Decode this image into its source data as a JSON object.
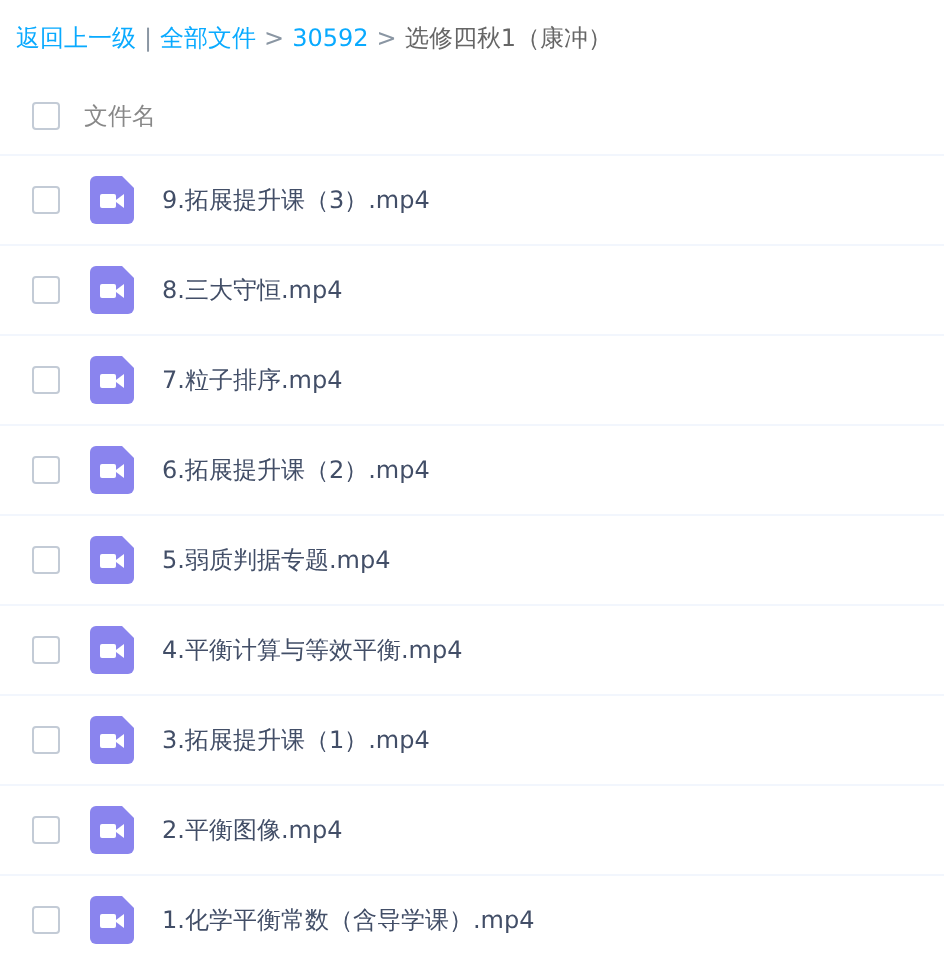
{
  "breadcrumb": [
    {
      "text": "返回上一级",
      "kind": "link"
    },
    {
      "text": "|",
      "kind": "separator"
    },
    {
      "text": "全部文件",
      "kind": "link"
    },
    {
      "text": ">",
      "kind": "separator"
    },
    {
      "text": "30592",
      "kind": "link"
    },
    {
      "text": ">",
      "kind": "separator"
    },
    {
      "text": "选修四秋1（康冲）",
      "kind": "current"
    }
  ],
  "header": {
    "label": "文件名",
    "checked": false
  },
  "files": [
    {
      "name": "9.拓展提升课（3）.mp4",
      "checked": false
    },
    {
      "name": "8.三大守恒.mp4",
      "checked": false
    },
    {
      "name": "7.粒子排序.mp4",
      "checked": false
    },
    {
      "name": "6.拓展提升课（2）.mp4",
      "checked": false
    },
    {
      "name": "5.弱质判据专题.mp4",
      "checked": false
    },
    {
      "name": "4.平衡计算与等效平衡.mp4",
      "checked": false
    },
    {
      "name": "3.拓展提升课（1）.mp4",
      "checked": false
    },
    {
      "name": "2.平衡图像.mp4",
      "checked": false
    },
    {
      "name": "1.化学平衡常数（含导学课）.mp4",
      "checked": false
    }
  ]
}
